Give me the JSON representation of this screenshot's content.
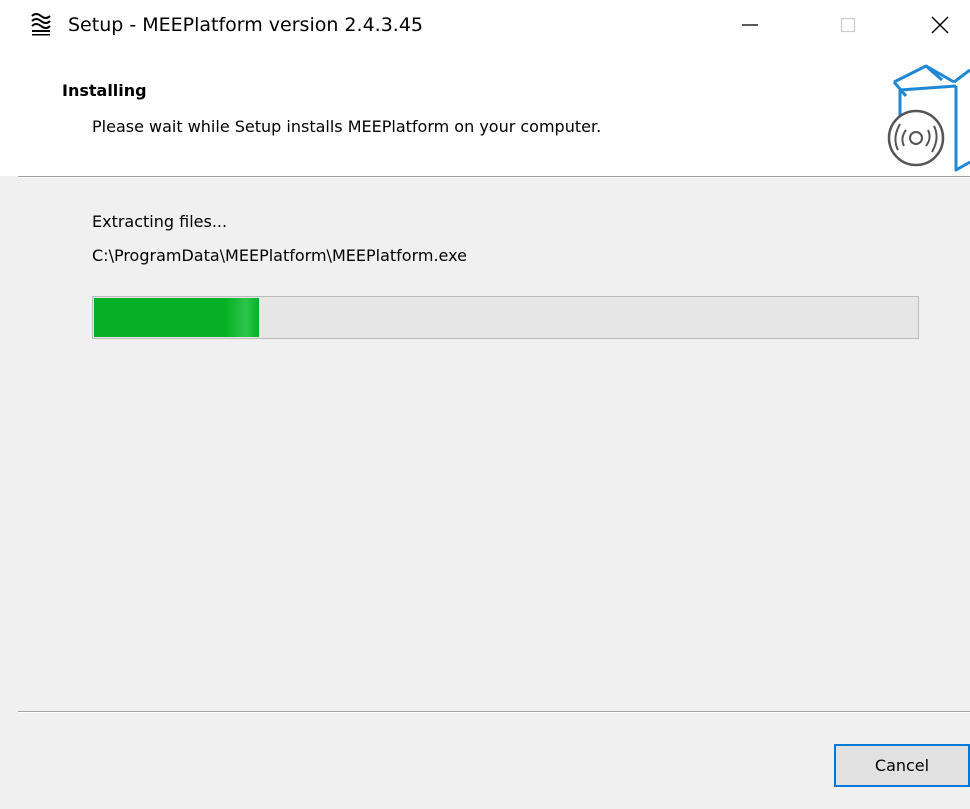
{
  "window": {
    "title": "Setup - MEEPlatform version 2.4.3.45"
  },
  "header": {
    "title": "Installing",
    "subtitle": "Please wait while Setup installs MEEPlatform on your computer."
  },
  "install": {
    "status": "Extracting files...",
    "current_file": "C:\\ProgramData\\MEEPlatform\\MEEPlatform.exe",
    "progress_fraction": 0.2
  },
  "buttons": {
    "cancel_label": "Cancel"
  },
  "icons": {
    "app": "app-logo-icon",
    "minimize": "minimize-icon",
    "maximize": "maximize-icon",
    "close": "close-icon",
    "header": "install-box-disc-icon"
  },
  "colors": {
    "progress_fill": "#06b025",
    "progress_track": "#e6e6e6",
    "focus_border": "#0078d7",
    "graphic_blue": "#1e88d6"
  }
}
